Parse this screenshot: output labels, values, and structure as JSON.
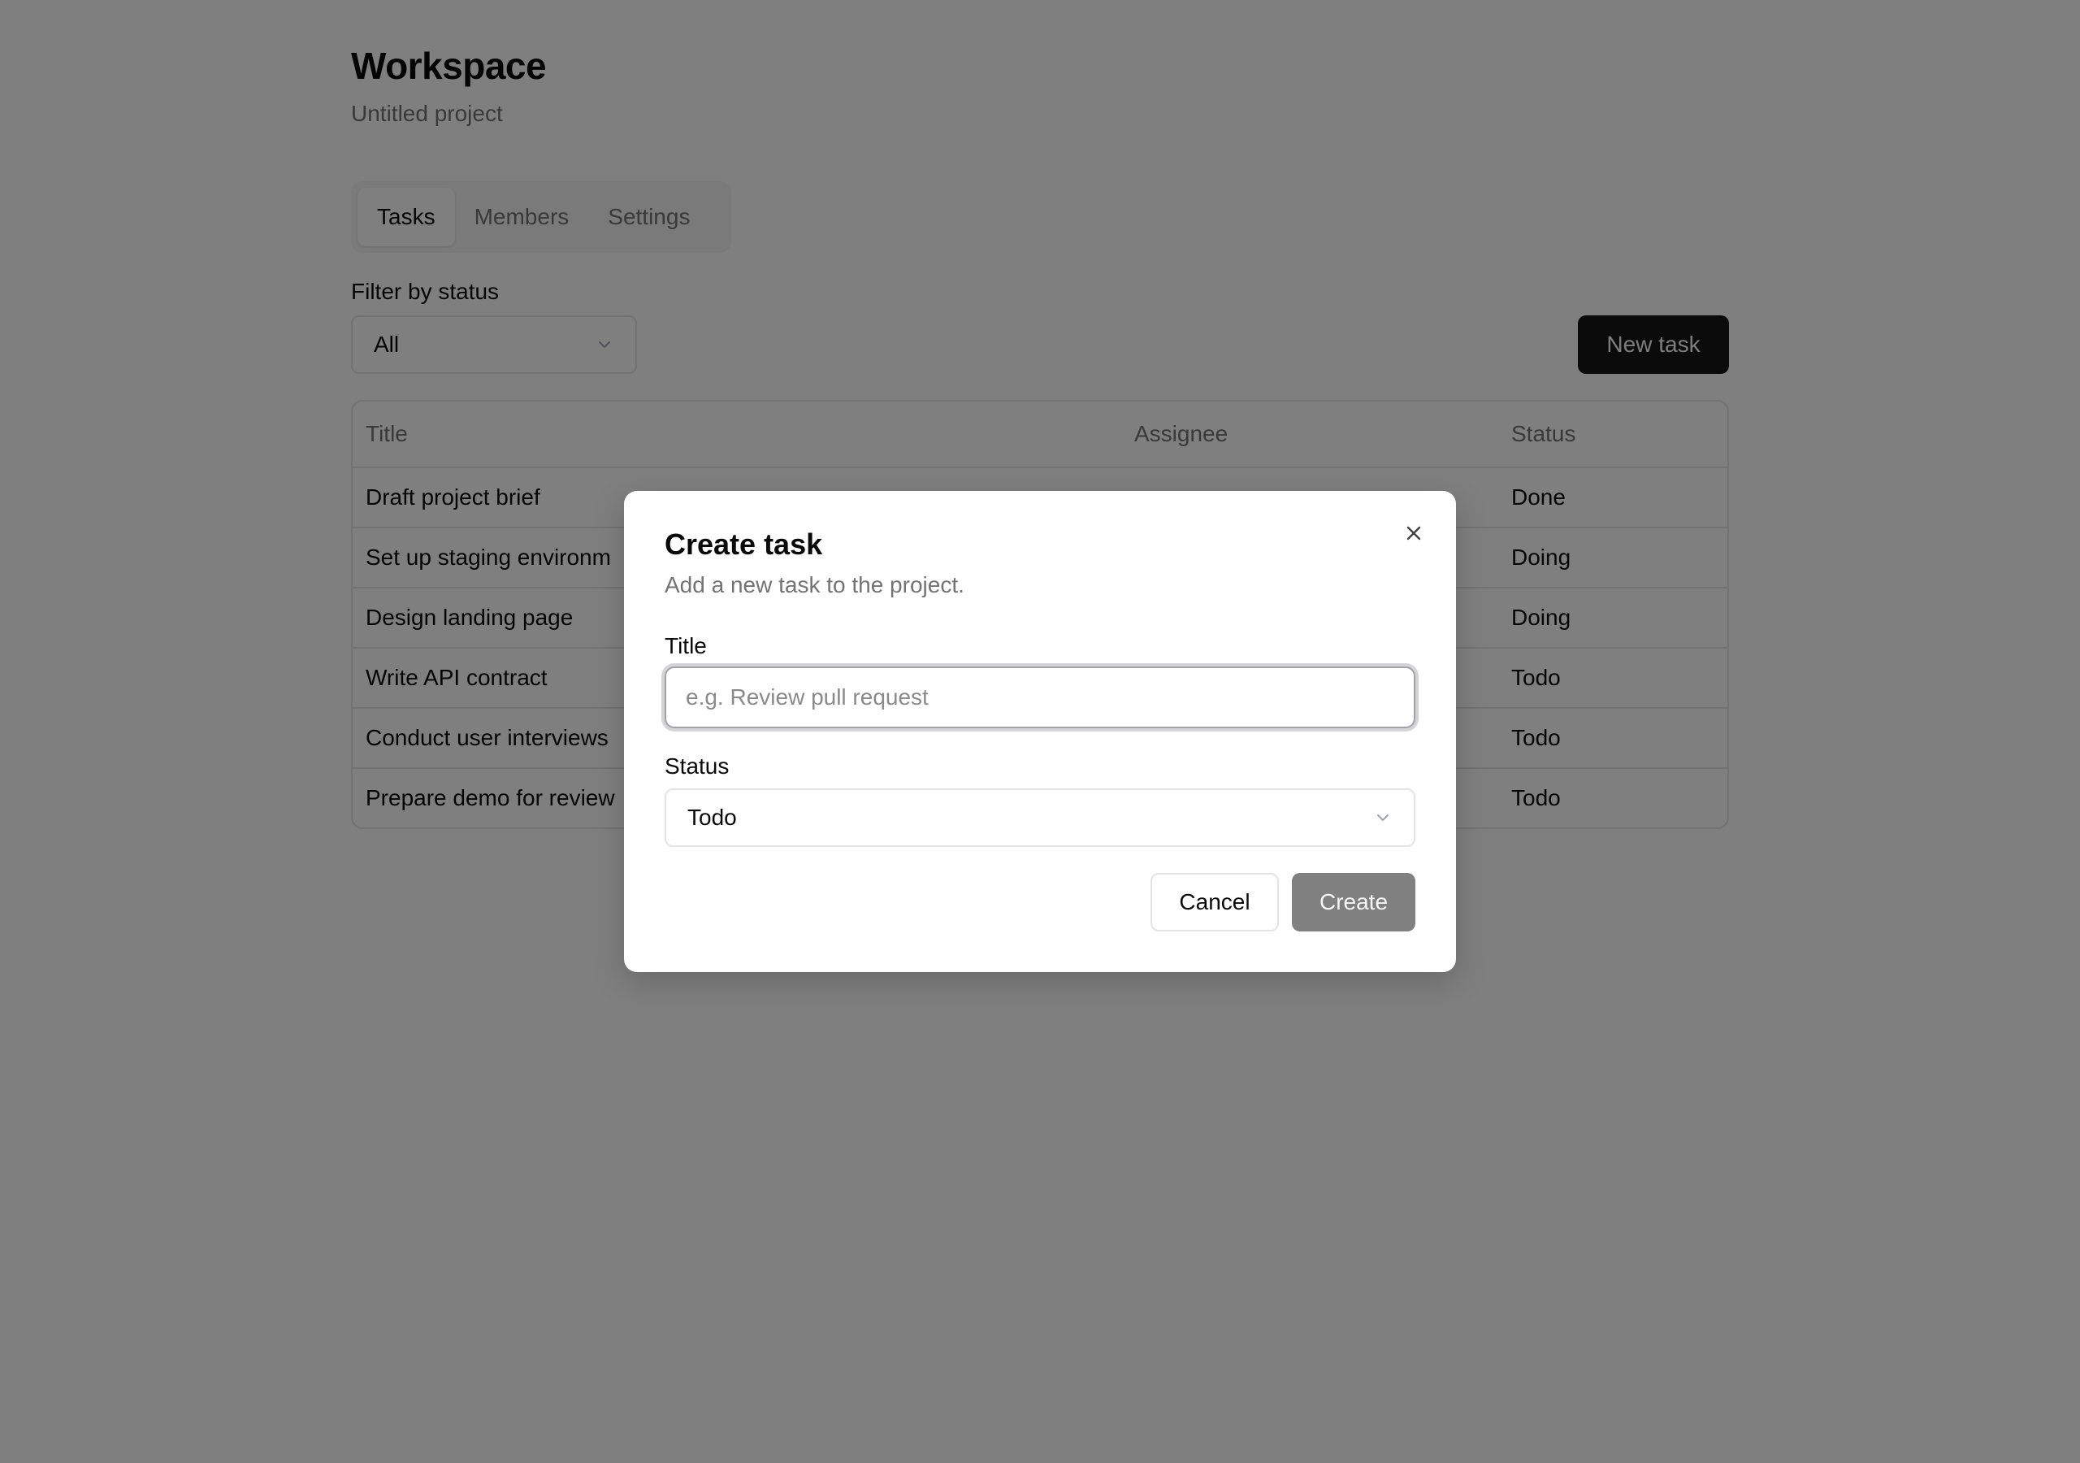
{
  "header": {
    "title": "Workspace",
    "subtitle": "Untitled project"
  },
  "tabs": [
    {
      "label": "Tasks",
      "active": true
    },
    {
      "label": "Members",
      "active": false
    },
    {
      "label": "Settings",
      "active": false
    }
  ],
  "filter": {
    "label": "Filter by status",
    "value": "All"
  },
  "toolbar": {
    "new_task_label": "New task"
  },
  "table": {
    "columns": [
      "Title",
      "Assignee",
      "Status"
    ],
    "rows": [
      {
        "title": "Draft project brief",
        "assignee": "",
        "status": "Done"
      },
      {
        "title": "Set up staging environm",
        "assignee": "",
        "status": "Doing"
      },
      {
        "title": "Design landing page",
        "assignee": "",
        "status": "Doing"
      },
      {
        "title": "Write API contract",
        "assignee": "",
        "status": "Todo"
      },
      {
        "title": "Conduct user interviews",
        "assignee": "",
        "status": "Todo"
      },
      {
        "title": "Prepare demo for review",
        "assignee": "",
        "status": "Todo"
      }
    ]
  },
  "dialog": {
    "title": "Create task",
    "description": "Add a new task to the project.",
    "title_label": "Title",
    "title_value": "",
    "title_placeholder": "e.g. Review pull request",
    "status_label": "Status",
    "status_value": "Todo",
    "cancel_label": "Cancel",
    "create_label": "Create"
  },
  "colors": {
    "primary": "#171717",
    "overlay": "rgba(0,0,0,0.5)",
    "muted": "#737373",
    "border": "#e4e4e7"
  },
  "icons": {
    "select": "chevron-down-icon",
    "close": "close-icon"
  }
}
